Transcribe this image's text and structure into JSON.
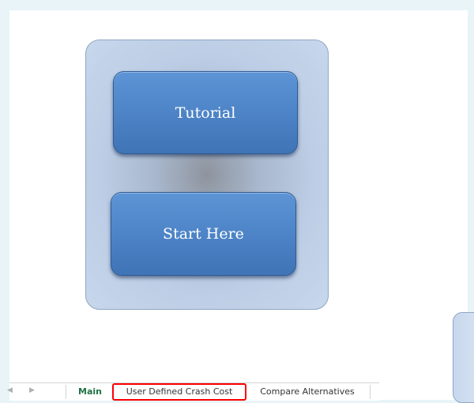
{
  "buttons": {
    "tutorial_label": "Tutorial",
    "start_label": "Start Here"
  },
  "tabs": [
    {
      "label": "Main",
      "active": true
    },
    {
      "label": "User Defined Crash Cost",
      "highlighted": true
    },
    {
      "label": "Compare Alternatives"
    }
  ],
  "icons": {
    "nav_left": "triangle-left-icon",
    "nav_right": "triangle-right-icon"
  },
  "colors": {
    "button_fill": "#4f86c9",
    "panel_fill": "#c7d7ec",
    "active_tab_text": "#217346",
    "highlight_border": "#ff0000"
  }
}
